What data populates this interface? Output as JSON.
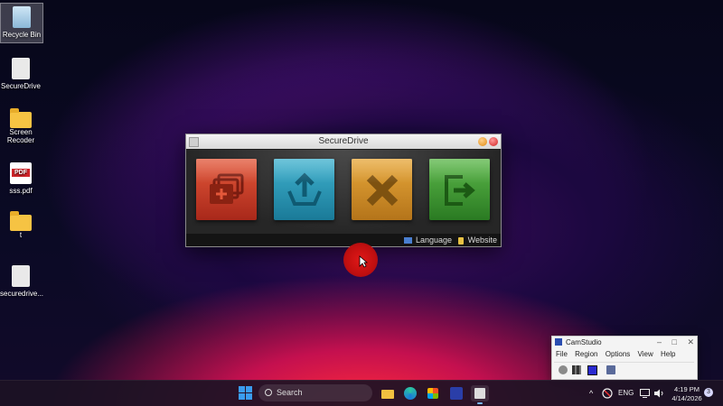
{
  "desktop": {
    "icons": [
      {
        "label": "Recycle Bin"
      },
      {
        "label": "SecureDrive"
      },
      {
        "label": "Screen Recoder"
      },
      {
        "label": "sss.pdf",
        "badge": "PDF"
      },
      {
        "label": "t"
      },
      {
        "label": "securedrive..."
      }
    ]
  },
  "securedrive": {
    "title": "SecureDrive",
    "tiles": [
      {
        "name": "add-drive",
        "icon": "add-drive-icon",
        "color": "#c83a22"
      },
      {
        "name": "upload",
        "icon": "upload-icon",
        "color": "#2a95b4"
      },
      {
        "name": "remove",
        "icon": "close-icon",
        "color": "#d08e2a"
      },
      {
        "name": "exit",
        "icon": "exit-icon",
        "color": "#42982f"
      }
    ],
    "footer": {
      "language": "Language",
      "website": "Website"
    }
  },
  "camstudio": {
    "title": "CamStudio",
    "controls": [
      "–",
      "□",
      "✕"
    ],
    "menu": [
      "File",
      "Region",
      "Options",
      "View",
      "Help"
    ]
  },
  "taskbar": {
    "search_label": "Search",
    "tray": {
      "chevron": "^",
      "language": "ENG",
      "time": "4:19 PM",
      "date": "4/14/2026",
      "notifications": "3"
    }
  }
}
